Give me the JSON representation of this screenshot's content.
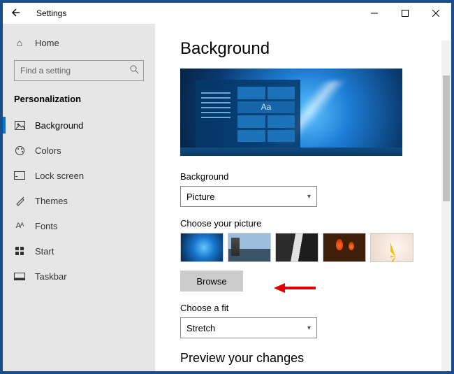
{
  "titlebar": {
    "back": "←",
    "title": "Settings"
  },
  "sidebar": {
    "home": "Home",
    "search_placeholder": "Find a setting",
    "section": "Personalization",
    "items": [
      {
        "label": "Background",
        "icon": "⊡",
        "active": true
      },
      {
        "label": "Colors",
        "icon": "❀"
      },
      {
        "label": "Lock screen",
        "icon": "▭"
      },
      {
        "label": "Themes",
        "icon": "✎"
      },
      {
        "label": "Fonts",
        "icon": "Aᴀ"
      },
      {
        "label": "Start",
        "icon": "⊞"
      },
      {
        "label": "Taskbar",
        "icon": "▥"
      }
    ]
  },
  "page": {
    "heading": "Background",
    "preview_aa": "Aa",
    "bg_label": "Background",
    "bg_value": "Picture",
    "choose_picture_label": "Choose your picture",
    "browse": "Browse",
    "fit_label": "Choose a fit",
    "fit_value": "Stretch",
    "preview_changes": "Preview your changes"
  }
}
